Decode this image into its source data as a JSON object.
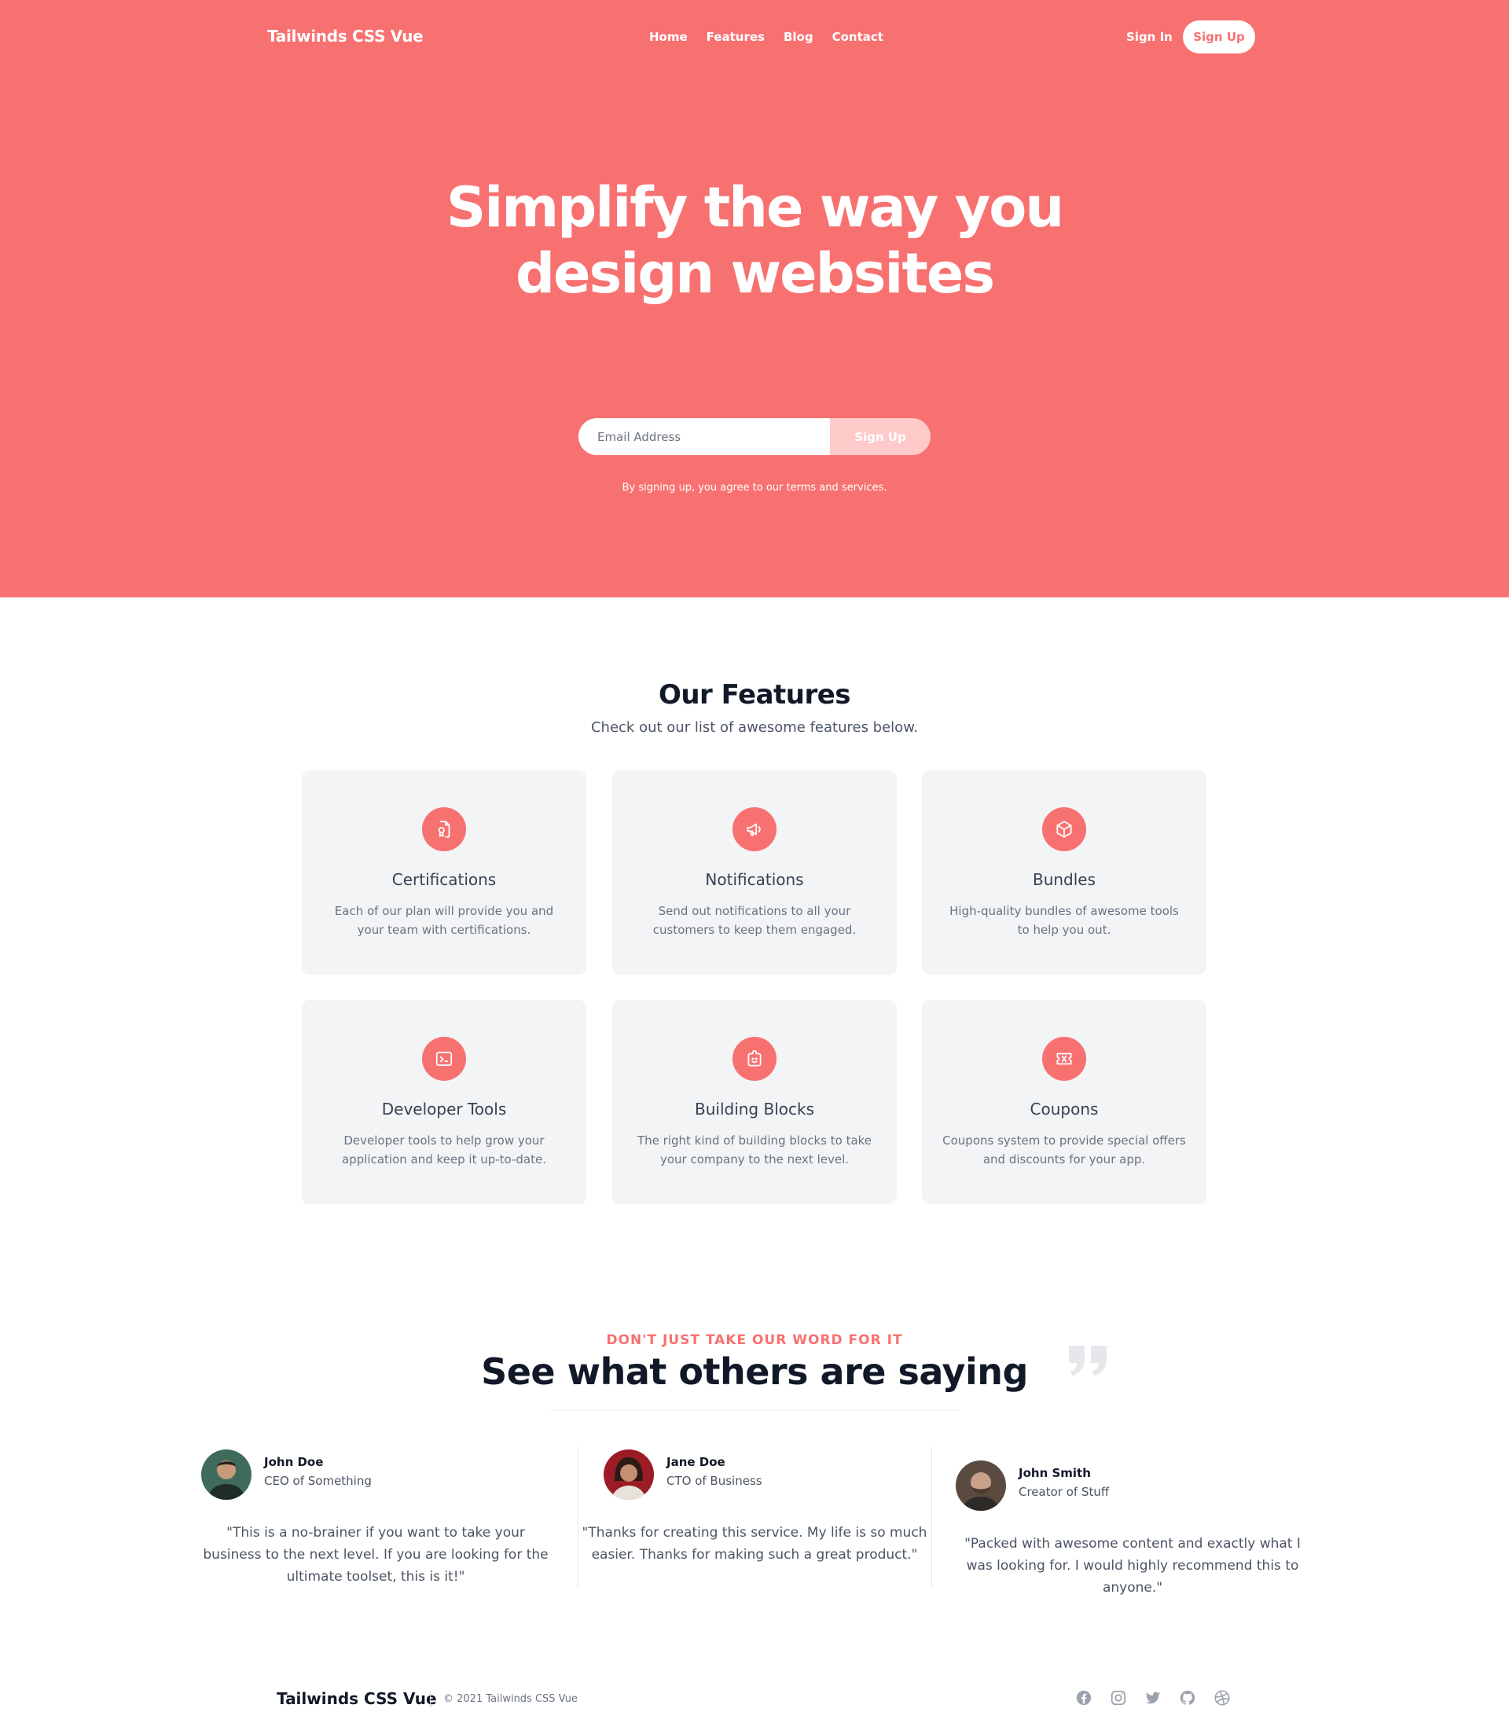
{
  "header": {
    "brand": "Tailwinds CSS Vue",
    "nav": [
      "Home",
      "Features",
      "Blog",
      "Contact"
    ],
    "sign_in": "Sign In",
    "sign_up": "Sign Up"
  },
  "hero": {
    "title": "Simplify the way you design websites",
    "email_placeholder": "Email Address",
    "button": "Sign Up",
    "terms": "By signing up, you agree to our terms and services."
  },
  "features": {
    "title": "Our Features",
    "subtitle": "Check out our list of awesome features below.",
    "items": [
      {
        "title": "Certifications",
        "desc": "Each of our plan will provide you and your team with certifications.",
        "icon": "certificate-icon"
      },
      {
        "title": "Notifications",
        "desc": "Send out notifications to all your customers to keep them engaged.",
        "icon": "megaphone-icon"
      },
      {
        "title": "Bundles",
        "desc": "High-quality bundles of awesome tools to help you out.",
        "icon": "cube-icon"
      },
      {
        "title": "Developer Tools",
        "desc": "Developer tools to help grow your application and keep it up-to-date.",
        "icon": "terminal-icon"
      },
      {
        "title": "Building Blocks",
        "desc": "The right kind of building blocks to take your company to the next level.",
        "icon": "puzzle-icon"
      },
      {
        "title": "Coupons",
        "desc": "Coupons system to provide special offers and discounts for your app.",
        "icon": "ticket-icon"
      }
    ]
  },
  "testimonials": {
    "eyebrow": "DON'T JUST TAKE OUR WORD FOR IT",
    "title": "See what others are saying",
    "items": [
      {
        "name": "John Doe",
        "role": "CEO of Something",
        "quote": "\"This is a no-brainer if you want to take your business to the next level. If you are looking for the ultimate toolset, this is it!\""
      },
      {
        "name": "Jane Doe",
        "role": "CTO of Business",
        "quote": "\"Thanks for creating this service. My life is so much easier. Thanks for making such a great product.\""
      },
      {
        "name": "John Smith",
        "role": "Creator of Stuff",
        "quote": "\"Packed with awesome content and exactly what I was looking for. I would highly recommend this to anyone.\""
      }
    ]
  },
  "footer": {
    "brand": "Tailwinds CSS Vue",
    "copyright": "© 2021 Tailwinds CSS Vue",
    "socials": [
      "facebook-icon",
      "instagram-icon",
      "twitter-icon",
      "github-icon",
      "dribbble-icon"
    ]
  },
  "colors": {
    "accent": "#f87171",
    "button_light": "#fecaca",
    "card_bg": "#f3f4f6"
  }
}
